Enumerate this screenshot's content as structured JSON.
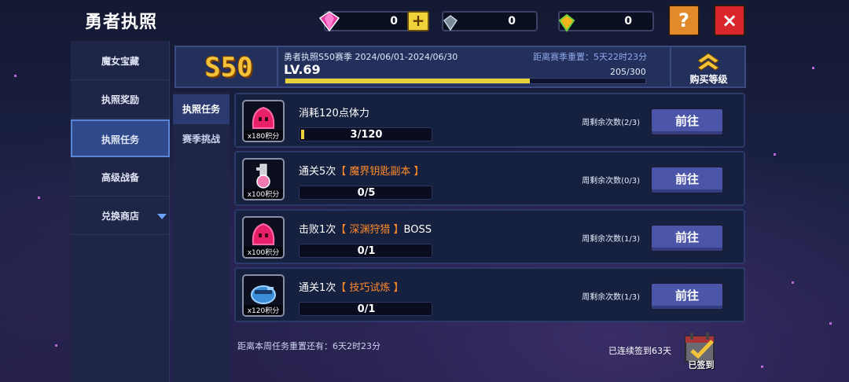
{
  "header": {
    "title": "勇者执照",
    "currencies": [
      {
        "icon": "gem-icon",
        "value": "0"
      },
      {
        "icon": "crystal-icon",
        "value": "0"
      },
      {
        "icon": "gold-gem-icon",
        "value": "0"
      }
    ],
    "plus_label": "+",
    "help_label": "?",
    "close_label": "×"
  },
  "sidebar": {
    "items": [
      {
        "label": "魔女宝藏"
      },
      {
        "label": "执照奖励"
      },
      {
        "label": "执照任务"
      },
      {
        "label": "高级战备"
      },
      {
        "label": "兑换商店"
      }
    ],
    "active_index": 2
  },
  "subtabs": {
    "items": [
      {
        "label": "执照任务"
      },
      {
        "label": "赛季挑战"
      }
    ],
    "active_index": 0
  },
  "season": {
    "badge": "S50",
    "name": "勇者执照S50赛季 2024/06/01-2024/06/30",
    "reset": "距离赛季重置：5天22时23分",
    "level": "LV.69",
    "xp": "205/300",
    "xp_progress": 0.68,
    "buy_level_label": "购买等级"
  },
  "tasks": [
    {
      "name": "消耗120点体力",
      "highlight": "",
      "suffix": "",
      "progress_text": "3/120",
      "progress": 0.025,
      "points": "x180积分",
      "remaining": "周剩余次数(2/3)",
      "go_label": "前往",
      "icon": "pink-slime-icon"
    },
    {
      "name": "通关5次",
      "highlight": "【 魔界钥匙副本 】",
      "suffix": "",
      "progress_text": "0/5",
      "progress": 0,
      "points": "x100积分",
      "remaining": "周剩余次数(0/3)",
      "go_label": "前往",
      "icon": "key-potion-icon"
    },
    {
      "name": "击败1次",
      "highlight": "【 深渊狩猎 】",
      "suffix": "BOSS",
      "progress_text": "0/1",
      "progress": 0,
      "points": "x100积分",
      "remaining": "周剩余次数(1/3)",
      "go_label": "前往",
      "icon": "pink-slime-icon"
    },
    {
      "name": "通关1次",
      "highlight": "【 技巧试炼 】",
      "suffix": "",
      "progress_text": "0/1",
      "progress": 0,
      "points": "x120积分",
      "remaining": "周剩余次数(1/3)",
      "go_label": "前往",
      "icon": "blue-creature-icon"
    }
  ],
  "footer": {
    "weekly_reset": "距离本周任务重置还有：6天2时23分",
    "signin_streak": "已连续签到63天",
    "signed_label": "已签到"
  },
  "colors": {
    "accent": "#e8d23c",
    "highlight": "#ff8a2a",
    "button": "#4b56a8",
    "close": "#d8262a",
    "help": "#e08a2a"
  }
}
